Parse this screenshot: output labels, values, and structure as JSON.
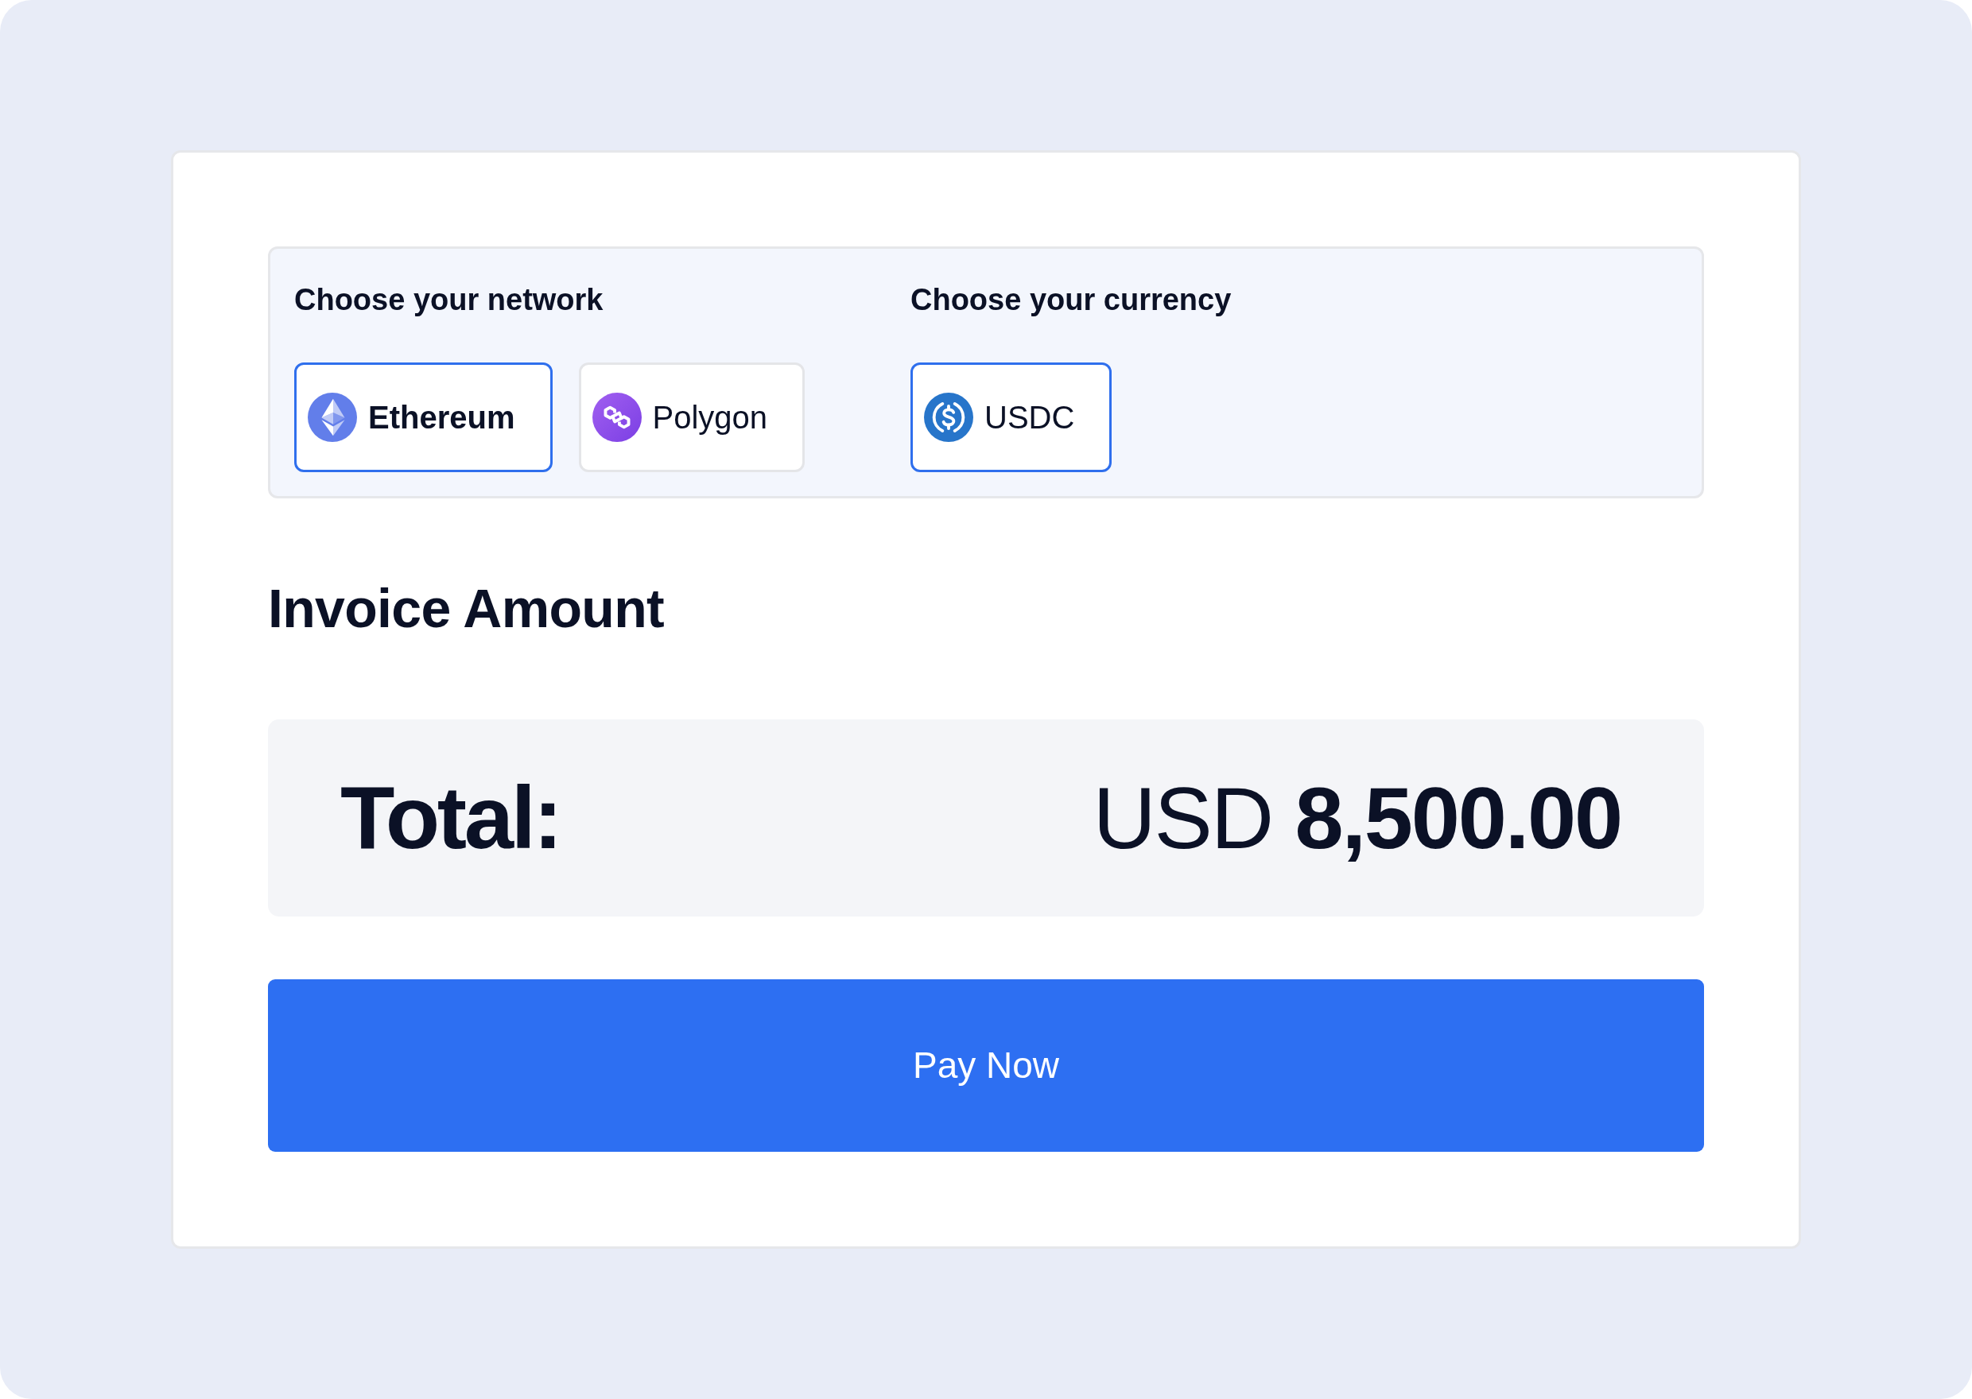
{
  "selectors": [
    {
      "heading": "Choose your network",
      "options": [
        {
          "kind": "ethereum",
          "label": "Ethereum",
          "selected": true,
          "bold": true
        },
        {
          "kind": "polygon",
          "label": "Polygon",
          "selected": false,
          "bold": false
        }
      ]
    },
    {
      "heading": "Choose your currency",
      "options": [
        {
          "kind": "usdc",
          "label": "USDC",
          "selected": true,
          "bold": false
        }
      ]
    }
  ],
  "invoice": {
    "title": "Invoice Amount",
    "total_label": "Total:",
    "currency": "USD",
    "amount": "8,500.00"
  },
  "pay_button": {
    "label": "Pay Now"
  }
}
